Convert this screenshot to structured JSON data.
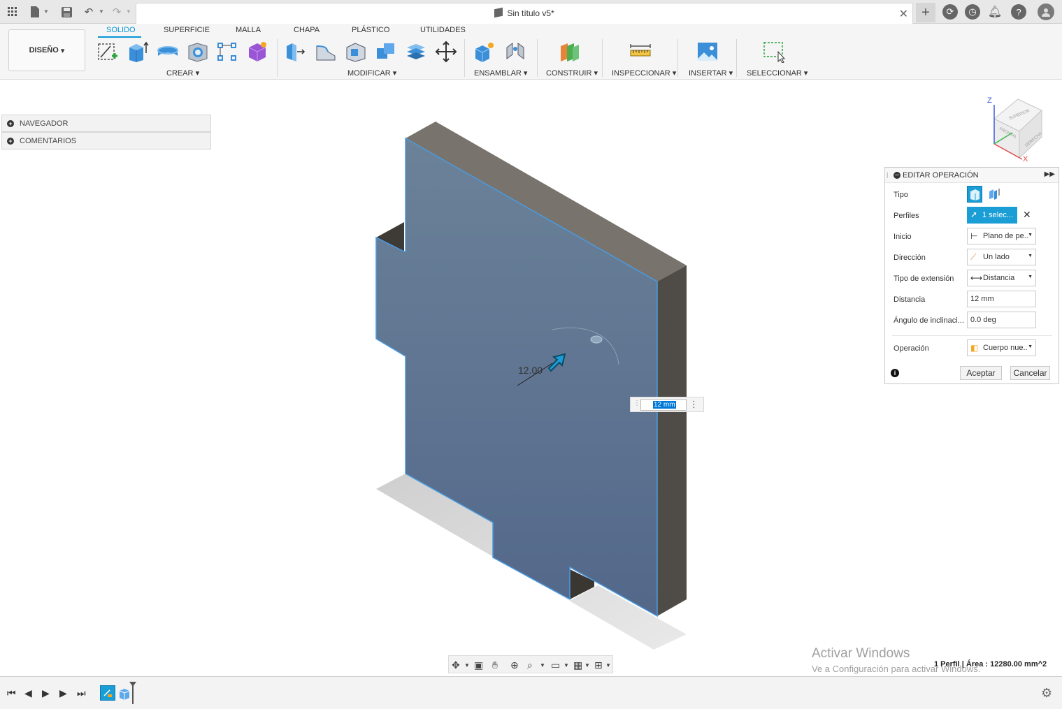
{
  "document": {
    "title": "Sin título v5*"
  },
  "ribbon": {
    "workspace": "DISEÑO",
    "tabs": [
      "SOLIDO",
      "SUPERFICIE",
      "MALLA",
      "CHAPA",
      "PLÁSTICO",
      "UTILIDADES"
    ],
    "active_tab": "SOLIDO",
    "groups": {
      "crear": "CREAR",
      "modificar": "MODIFICAR",
      "ensamblar": "ENSAMBLAR",
      "construir": "CONSTRUIR",
      "inspeccionar": "INSPECCIONAR",
      "insertar": "INSERTAR",
      "seleccionar": "SELECCIONAR"
    }
  },
  "browser": {
    "items": [
      "NAVEGADOR",
      "COMENTARIOS"
    ]
  },
  "viewcube": {
    "axis_z": "Z",
    "axis_x": "X",
    "faces": [
      "SUPERIOR",
      "FRONTAL",
      "DERECHA"
    ]
  },
  "canvas": {
    "dimension_label": "12.00",
    "distance_input": "12 mm"
  },
  "dialog": {
    "title": "EDITAR OPERACIÓN",
    "rows": {
      "tipo": "Tipo",
      "perfiles": "Perfiles",
      "perfiles_value": "1 selec...",
      "inicio": "Inicio",
      "inicio_value": "Plano de pe...",
      "direccion": "Dirección",
      "direccion_value": "Un lado",
      "tipo_extension": "Tipo de extensión",
      "tipo_extension_value": "Distancia",
      "distancia": "Distancia",
      "distancia_value": "12 mm",
      "angulo": "Ángulo de inclinaci...",
      "angulo_value": "0.0 deg",
      "operacion": "Operación",
      "operacion_value": "Cuerpo nue..."
    },
    "accept": "Aceptar",
    "cancel": "Cancelar"
  },
  "status": {
    "text": "1 Perfil | Área : 12280.00 mm^2"
  },
  "watermark": {
    "line1": "Activar Windows",
    "line2": "Ve a Configuración para activar Windows."
  },
  "colors": {
    "accent": "#0696d7",
    "face": "#5f7893",
    "side": "#4e4a45",
    "top": "#77726b"
  }
}
